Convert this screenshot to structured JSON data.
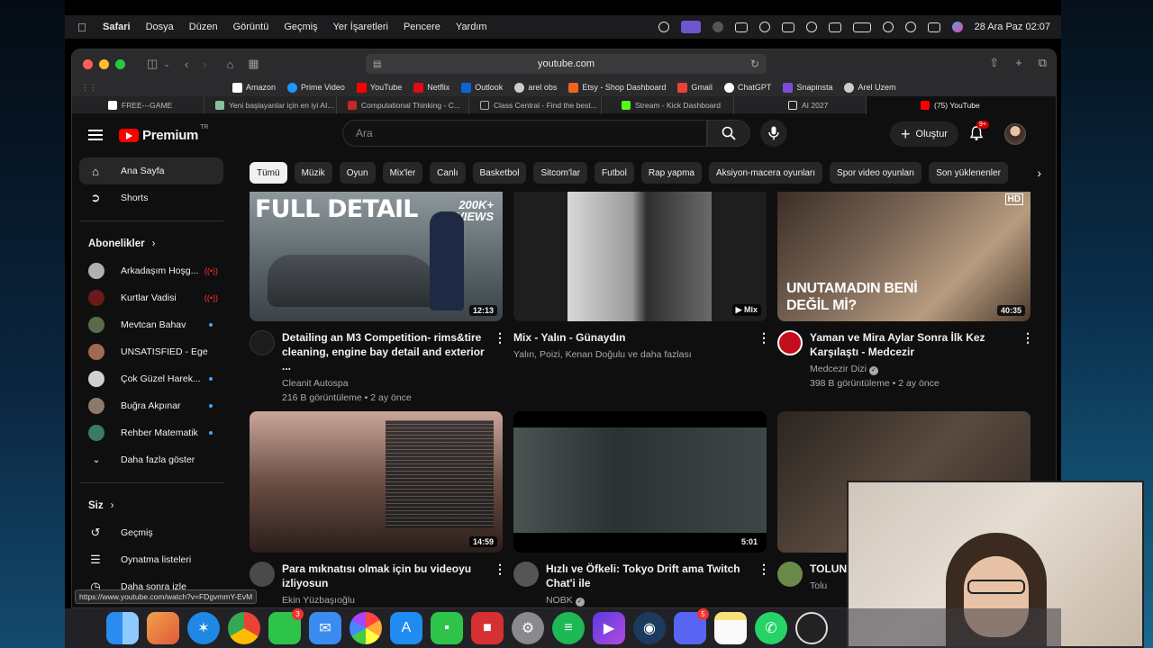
{
  "menubar": {
    "app": "Safari",
    "items": [
      "Dosya",
      "Düzen",
      "Görüntü",
      "Geçmiş",
      "Yer İşaretleri",
      "Pencere",
      "Yardım"
    ],
    "clock": "28 Ara Paz  02:07"
  },
  "browser": {
    "url": "youtube.com",
    "bookmarks": [
      {
        "label": "Amazon",
        "color": "#ffffff"
      },
      {
        "label": "Prime Video",
        "color": "#1a98ff"
      },
      {
        "label": "YouTube",
        "color": "#ff0000"
      },
      {
        "label": "Netflix",
        "color": "#e50914"
      },
      {
        "label": "Outlook",
        "color": "#0a64d8"
      },
      {
        "label": "arel obs",
        "color": "#cccccc"
      },
      {
        "label": "Etsy - Shop Dashboard",
        "color": "#f1641e"
      },
      {
        "label": "Gmail",
        "color": "#ea4335"
      },
      {
        "label": "ChatGPT",
        "color": "#ffffff"
      },
      {
        "label": "Snapinsta",
        "color": "#7b4dd6"
      },
      {
        "label": "Arel Uzem",
        "color": "#cccccc"
      }
    ],
    "tabs": [
      {
        "label": "FREE---GAME",
        "color": "#ffffff"
      },
      {
        "label": "Yeni başlayanlar için en iyi AI...",
        "color": "#88c0a0"
      },
      {
        "label": "Computational Thinking - C...",
        "color": "#c62828"
      },
      {
        "label": "Class Central - Find the best...",
        "color": "#444444"
      },
      {
        "label": "Stream - Kick Dashboard",
        "color": "#53fc18"
      },
      {
        "label": "AI 2027",
        "color": "#dddddd"
      },
      {
        "label": "(75) YouTube",
        "color": "#ff0000"
      }
    ],
    "status_url": "https://www.youtube.com/watch?v=FDgvmmY-EvM"
  },
  "youtube": {
    "logo": "Premium",
    "region": "TR",
    "search_placeholder": "Ara",
    "create_label": "Oluştur",
    "notifications": "9+",
    "sidebar": {
      "main": [
        {
          "label": "Ana Sayfa",
          "icon": "home-icon"
        },
        {
          "label": "Shorts",
          "icon": "shorts-icon"
        }
      ],
      "subscriptions_title": "Abonelikler",
      "subscriptions": [
        {
          "label": "Arkadaşım Hoşg...",
          "live": true,
          "color": "#b0b0b0"
        },
        {
          "label": "Kurtlar Vadisi",
          "live": true,
          "color": "#6b1a1a"
        },
        {
          "label": "Mevtcan Bahav",
          "live": false,
          "color": "#5a6b4a"
        },
        {
          "label": "UNSATISFIED - Ege ...",
          "live": false,
          "color": "#a06a50"
        },
        {
          "label": "Çok Güzel Harek...",
          "live": false,
          "color": "#d0d0d0"
        },
        {
          "label": "Buğra Akpınar",
          "live": false,
          "color": "#8a7a6a"
        },
        {
          "label": "Rehber Matematik",
          "live": false,
          "color": "#3a7a6a"
        }
      ],
      "show_more": "Daha fazla göster",
      "you_title": "Siz",
      "you_items": [
        {
          "label": "Geçmiş",
          "icon": "history-icon"
        },
        {
          "label": "Oynatma listeleri",
          "icon": "playlist-icon"
        },
        {
          "label": "Daha sonra izle",
          "icon": "watch-later-icon"
        }
      ]
    },
    "chips": [
      "Tümü",
      "Müzik",
      "Oyun",
      "Mix'ler",
      "Canlı",
      "Basketbol",
      "Sitcom'lar",
      "Futbol",
      "Rap yapma",
      "Aksiyon-macera oyunları",
      "Spor video oyunları",
      "Son yüklenenler"
    ],
    "videos": [
      {
        "title": "Detailing an M3 Competition- rims&tire cleaning, engine bay detail and exterior ...",
        "channel": "Cleanit Autospa",
        "stats": "216 B görüntüleme • 2 ay önce",
        "duration": "12:13",
        "overlay": "FULL DETAIL",
        "badge": "200K+ VIEWS",
        "thumb_bg": "#6d7a80",
        "channel_color": "#1c1c1c"
      },
      {
        "title": "Mix - Yalın - Günaydın",
        "channel": "Yalın, Poizi, Kenan Doğulu ve daha fazlası",
        "stats": "",
        "duration": "Mix",
        "overlay": "",
        "badge": "",
        "thumb_bg": "#2b2b2b",
        "channel_color": ""
      },
      {
        "title": "Yaman ve Mira Aylar Sonra İlk Kez Karşılaştı - Medcezir",
        "channel": "Medcezir Dizi",
        "stats": "398 B görüntüleme • 2 ay önce",
        "duration": "40:35",
        "overlay": "UNUTAMADIN BENİ DEĞİL Mİ?",
        "badge": "HD",
        "thumb_bg": "#5a4a3e",
        "channel_color": "#c40e1e"
      },
      {
        "title": "Para mıknatısı olmak için bu videoyu izliyosun",
        "channel": "Ekin Yüzbaşıoğlu",
        "stats": "",
        "duration": "14:59",
        "overlay": "",
        "badge": "",
        "thumb_bg": "#3a2a22",
        "channel_color": "#4a4a4a"
      },
      {
        "title": "Hızlı ve Öfkeli: Tokyo Drift ama Twitch Chat'i ile",
        "channel": "NOBK",
        "stats": "",
        "duration": "5:01",
        "overlay": "",
        "badge": "",
        "thumb_bg": "#2c3436",
        "channel_color": "#555555"
      },
      {
        "title": "TOLUNAY ... BÜYÜK...",
        "channel": "Tolu",
        "stats": "",
        "duration": "",
        "overlay": "",
        "badge": "",
        "thumb_bg": "#3c2e24",
        "channel_color": "#6a8a4a"
      }
    ]
  },
  "dock": [
    {
      "name": "finder-icon",
      "color": "#2a8cf0",
      "badge": ""
    },
    {
      "name": "launchpad-icon",
      "color": "#e87f3a",
      "badge": ""
    },
    {
      "name": "safari-icon",
      "color": "#1e88e5",
      "badge": ""
    },
    {
      "name": "chrome-icon",
      "color": "#e8e8e8",
      "badge": ""
    },
    {
      "name": "messages-icon",
      "color": "#2ec44a",
      "badge": "3"
    },
    {
      "name": "mail-icon",
      "color": "#3a8cf0",
      "badge": ""
    },
    {
      "name": "photos-icon",
      "color": "#f5f5f5",
      "badge": ""
    },
    {
      "name": "app-store-icon",
      "color": "#1e8cf0",
      "badge": ""
    },
    {
      "name": "facetime-icon",
      "color": "#2ec44a",
      "badge": ""
    },
    {
      "name": "pdf-icon",
      "color": "#d63030",
      "badge": ""
    },
    {
      "name": "settings-icon",
      "color": "#8a8a8e",
      "badge": ""
    },
    {
      "name": "spotify-icon",
      "color": "#1db954",
      "badge": ""
    },
    {
      "name": "video-player-icon",
      "color": "#7a4ae0",
      "badge": ""
    },
    {
      "name": "steam-icon",
      "color": "#1b3a5e",
      "badge": ""
    },
    {
      "name": "discord-icon",
      "color": "#5865f2",
      "badge": "5"
    },
    {
      "name": "notes-icon",
      "color": "#f6e27a",
      "badge": ""
    },
    {
      "name": "whatsapp-icon",
      "color": "#25d366",
      "badge": ""
    },
    {
      "name": "obs-icon",
      "color": "#222222",
      "badge": ""
    }
  ]
}
